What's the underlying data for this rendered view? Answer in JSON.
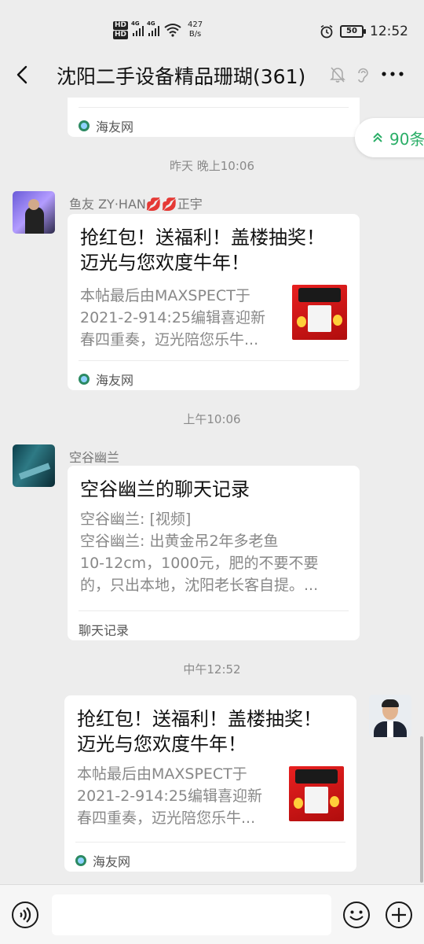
{
  "status_bar": {
    "network": "4G",
    "speed_value": "427",
    "speed_unit": "B/s",
    "battery": "50",
    "time": "12:52"
  },
  "nav": {
    "title": "沈阳二手设备精品珊瑚(361)"
  },
  "jump_pill": {
    "label": "90条"
  },
  "messages": [
    {
      "type": "link",
      "source": "海友网"
    },
    {
      "type": "time",
      "text": "昨天 晚上10:06"
    },
    {
      "type": "link",
      "sender": "鱼友 ZY·HAN💋💋正宇",
      "title_lines": [
        "抢红包！送福利！盖楼抽奖！",
        "迈光与您欢度牛年！"
      ],
      "desc_lines": [
        "本帖最后由MAXSPECT于",
        "2021-2-914:25编辑喜迎新",
        "春四重奏，迈光陪您乐牛..."
      ],
      "source": "海友网"
    },
    {
      "type": "time",
      "text": "上午10:06"
    },
    {
      "type": "chat_record",
      "sender": "空谷幽兰",
      "title": "空谷幽兰的聊天记录",
      "desc_lines": [
        "空谷幽兰: [视频]",
        "空谷幽兰: 出黄金吊2年多老鱼",
        "10-12cm，1000元，肥的不要不要",
        "的，只出本地，沈阳老长客自提。..."
      ],
      "footer": "聊天记录"
    },
    {
      "type": "time",
      "text": "中午12:52"
    },
    {
      "type": "link",
      "self": true,
      "title_lines": [
        "抢红包！送福利！盖楼抽奖！",
        "迈光与您欢度牛年！"
      ],
      "desc_lines": [
        "本帖最后由MAXSPECT于",
        "2021-2-914:25编辑喜迎新",
        "春四重奏，迈光陪您乐牛..."
      ],
      "source": "海友网"
    }
  ],
  "input": {
    "placeholder": ""
  }
}
